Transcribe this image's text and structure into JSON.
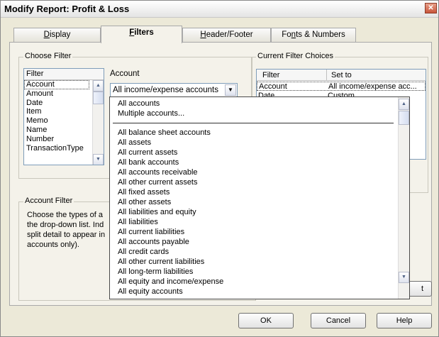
{
  "window": {
    "title": "Modify Report: Profit & Loss",
    "close_glyph": "✕"
  },
  "tabs": [
    {
      "mnemonic": "D",
      "rest": "isplay",
      "active": false
    },
    {
      "mnemonic": "F",
      "rest": "ilters",
      "active": true
    },
    {
      "mnemonic": "H",
      "rest": "eader/Footer",
      "active": false
    },
    {
      "prefix": "Fo",
      "mnemonic": "n",
      "rest": "ts & Numbers",
      "active": false
    }
  ],
  "choose_filter": {
    "group_label": "Choose Filter",
    "list_header": "Filter",
    "items": [
      "Account",
      "Amount",
      "Date",
      "Item",
      "Memo",
      "Name",
      "Number",
      "TransactionType"
    ],
    "selected": "Account",
    "account_label": "Account",
    "account_combo_value": "All income/expense accounts"
  },
  "account_filter": {
    "group_label": "Account Filter",
    "desc_lines": [
      "Choose the types of a",
      "the drop-down list. Ind",
      "split detail to appear in",
      "accounts only)."
    ]
  },
  "current_filter_choices": {
    "group_label": "Current Filter Choices",
    "col_filter": "Filter",
    "col_set_to": "Set to",
    "rows": [
      {
        "filter": "Account",
        "set_to": "All income/expense acc..."
      },
      {
        "filter": "Date",
        "set_to": "Custom"
      }
    ]
  },
  "dropdown": {
    "top_items": [
      "All accounts",
      "Multiple accounts..."
    ],
    "items": [
      "All balance sheet accounts",
      "All assets",
      "All current assets",
      "All bank accounts",
      "All accounts receivable",
      "All other current assets",
      "All fixed assets",
      "All other assets",
      "All liabilities and equity",
      "All liabilities",
      "All current liabilities",
      "All accounts payable",
      "All credit cards",
      "All other current liabilities",
      "All long-term liabilities",
      "All equity and income/expense",
      "All equity accounts"
    ]
  },
  "side_button_visible_text": "t",
  "buttons": {
    "ok": "OK",
    "cancel": "Cancel",
    "help": "Help"
  }
}
